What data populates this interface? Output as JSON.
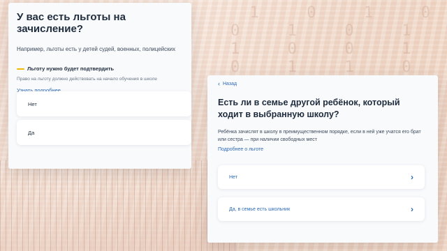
{
  "background": {
    "digits": "1  0  1  0\n0  1  0  1  1\n1  0  0  1  0  1\n0  1  1  0  1  1"
  },
  "card_left": {
    "title": "У вас есть льготы на зачисление?",
    "subtitle": "Например, льготы есть у детей судей, военных, полицейских",
    "notice": "Льготу нужно будет подтвердить",
    "notice_note": "Право на льготу должно действовать на начало обучения в школе",
    "link": "Узнать подробнее",
    "options": [
      "Нет",
      "Да"
    ]
  },
  "card_right": {
    "back": "Назад",
    "title": "Есть ли в семье другой ребёнок, который ходит в выбранную школу?",
    "description": "Ребёнка зачислят в школу в преимущественном порядке, если в ней уже учатся его брат или сестра — при наличии свободных мест",
    "link": "Подробнее о льготе",
    "options": [
      "Нет",
      "Да, в семье есть школьник"
    ]
  },
  "colors": {
    "accent": "#2e6ab5",
    "text": "#1f2c3d",
    "notice_bar": "#f2b705"
  }
}
